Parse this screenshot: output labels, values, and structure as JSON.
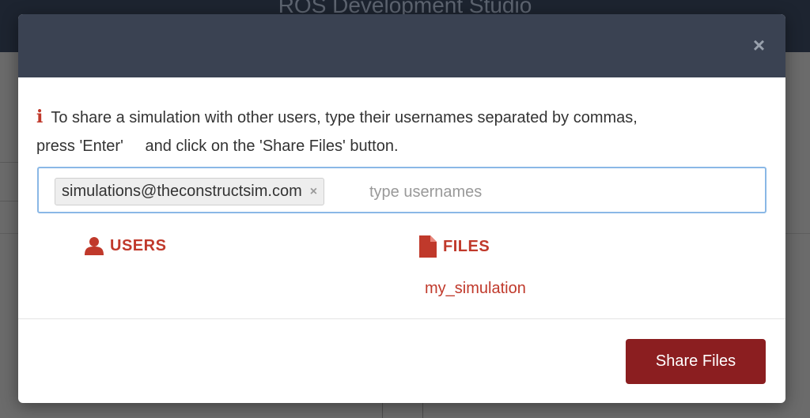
{
  "app": {
    "title": "ROS Development Studio"
  },
  "modal": {
    "close_label": "×",
    "info_line1": "To share a simulation with other users, type their usernames separated by commas,",
    "info_line2_a": "press 'Enter'",
    "info_line2_b": "and click on the 'Share Files' button.",
    "info_icon": "i",
    "tags": [
      {
        "label": "simulations@theconstructsim.com",
        "remove": "×"
      }
    ],
    "input_placeholder": "type usernames",
    "users_label": "USERS",
    "files_label": "FILES",
    "files": [
      "my_simulation"
    ],
    "share_button": "Share Files"
  },
  "colors": {
    "accent": "#c0392b",
    "button": "#8b1e20",
    "header": "#3a4252"
  }
}
